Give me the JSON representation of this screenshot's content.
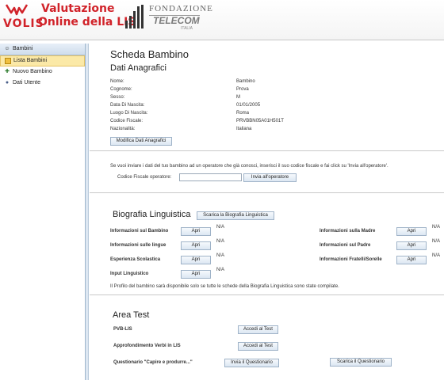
{
  "header": {
    "logo_volis": "VOLIS",
    "logo_line1": "Valutazione",
    "logo_line2": "Online della LIS",
    "foundation": "FONDAZIONE",
    "telecom": "TELECOM",
    "telecom_sub": "ITALIA"
  },
  "sidebar": {
    "header": "Bambini",
    "items": [
      {
        "label": "Lista Bambini",
        "icon": "list-icon"
      },
      {
        "label": "Nuovo Bambino",
        "icon": "add-child-icon"
      },
      {
        "label": "Dati Utente",
        "icon": "user-icon"
      }
    ]
  },
  "main": {
    "title": "Scheda Bambino",
    "anagrafica": {
      "title": "Dati Anagrafici",
      "fields": [
        {
          "label": "Nome:",
          "value": "Bambino"
        },
        {
          "label": "Cognome:",
          "value": "Prova"
        },
        {
          "label": "Sesso:",
          "value": "M"
        },
        {
          "label": "Data Di Nascita:",
          "value": "01/01/2005"
        },
        {
          "label": "Luogo Di Nascita:",
          "value": "Roma"
        },
        {
          "label": "Codice Fiscale:",
          "value": "PRVBBN05A01H501T"
        },
        {
          "label": "Nazionalità:",
          "value": "Italiana"
        }
      ],
      "edit_button": "Modifica Dati Anagrafici"
    },
    "operator": {
      "text": "Se vuoi inviare i dati del tuo bambino ad un operatore che già conosci, inserisci il suo codice fiscale e fai click su 'Invia all'operatore'.",
      "label": "Codice Fiscale operatore:",
      "input_value": "",
      "button": "Invia all'operatore"
    },
    "biografia": {
      "title": "Biografia Linguistica",
      "download_button": "Scarica la Biografia Linguistica",
      "left": [
        {
          "label": "Informazioni sul Bambino",
          "button": "Apri",
          "status": "N/A"
        },
        {
          "label": "Informazioni sulle lingue",
          "button": "Apri",
          "status": "N/A"
        },
        {
          "label": "Esperienza Scolastica",
          "button": "Apri",
          "status": "N/A"
        },
        {
          "label": "Input Linguistico",
          "button": "Apri",
          "status": "N/A"
        }
      ],
      "right": [
        {
          "label": "Informazioni sulla Madre",
          "button": "Apri",
          "status": "N/A"
        },
        {
          "label": "Informazioni sul Padre",
          "button": "Apri",
          "status": "N/A"
        },
        {
          "label": "Informazioni Fratelli/Sorelle",
          "button": "Apri",
          "status": "N/A"
        }
      ],
      "note": "Il Profilo del bambino sarà disponibile solo se tutte le schede della Biografia Linguistica sono state compilate."
    },
    "test": {
      "title": "Area Test",
      "rows": [
        {
          "label": "PVB-LIS",
          "button": "Accedi al Test"
        },
        {
          "label": "Approfondimento Verbi in LIS",
          "button": "Accedi al Test"
        },
        {
          "label": "Questionario \"Capire e produrre...\"",
          "button": "Invia il Questionario",
          "extra_button": "Scarica il Questionario"
        }
      ]
    }
  },
  "colors": {
    "brand_red": "#d1232a",
    "sidebar_active": "#fbe9a7"
  }
}
